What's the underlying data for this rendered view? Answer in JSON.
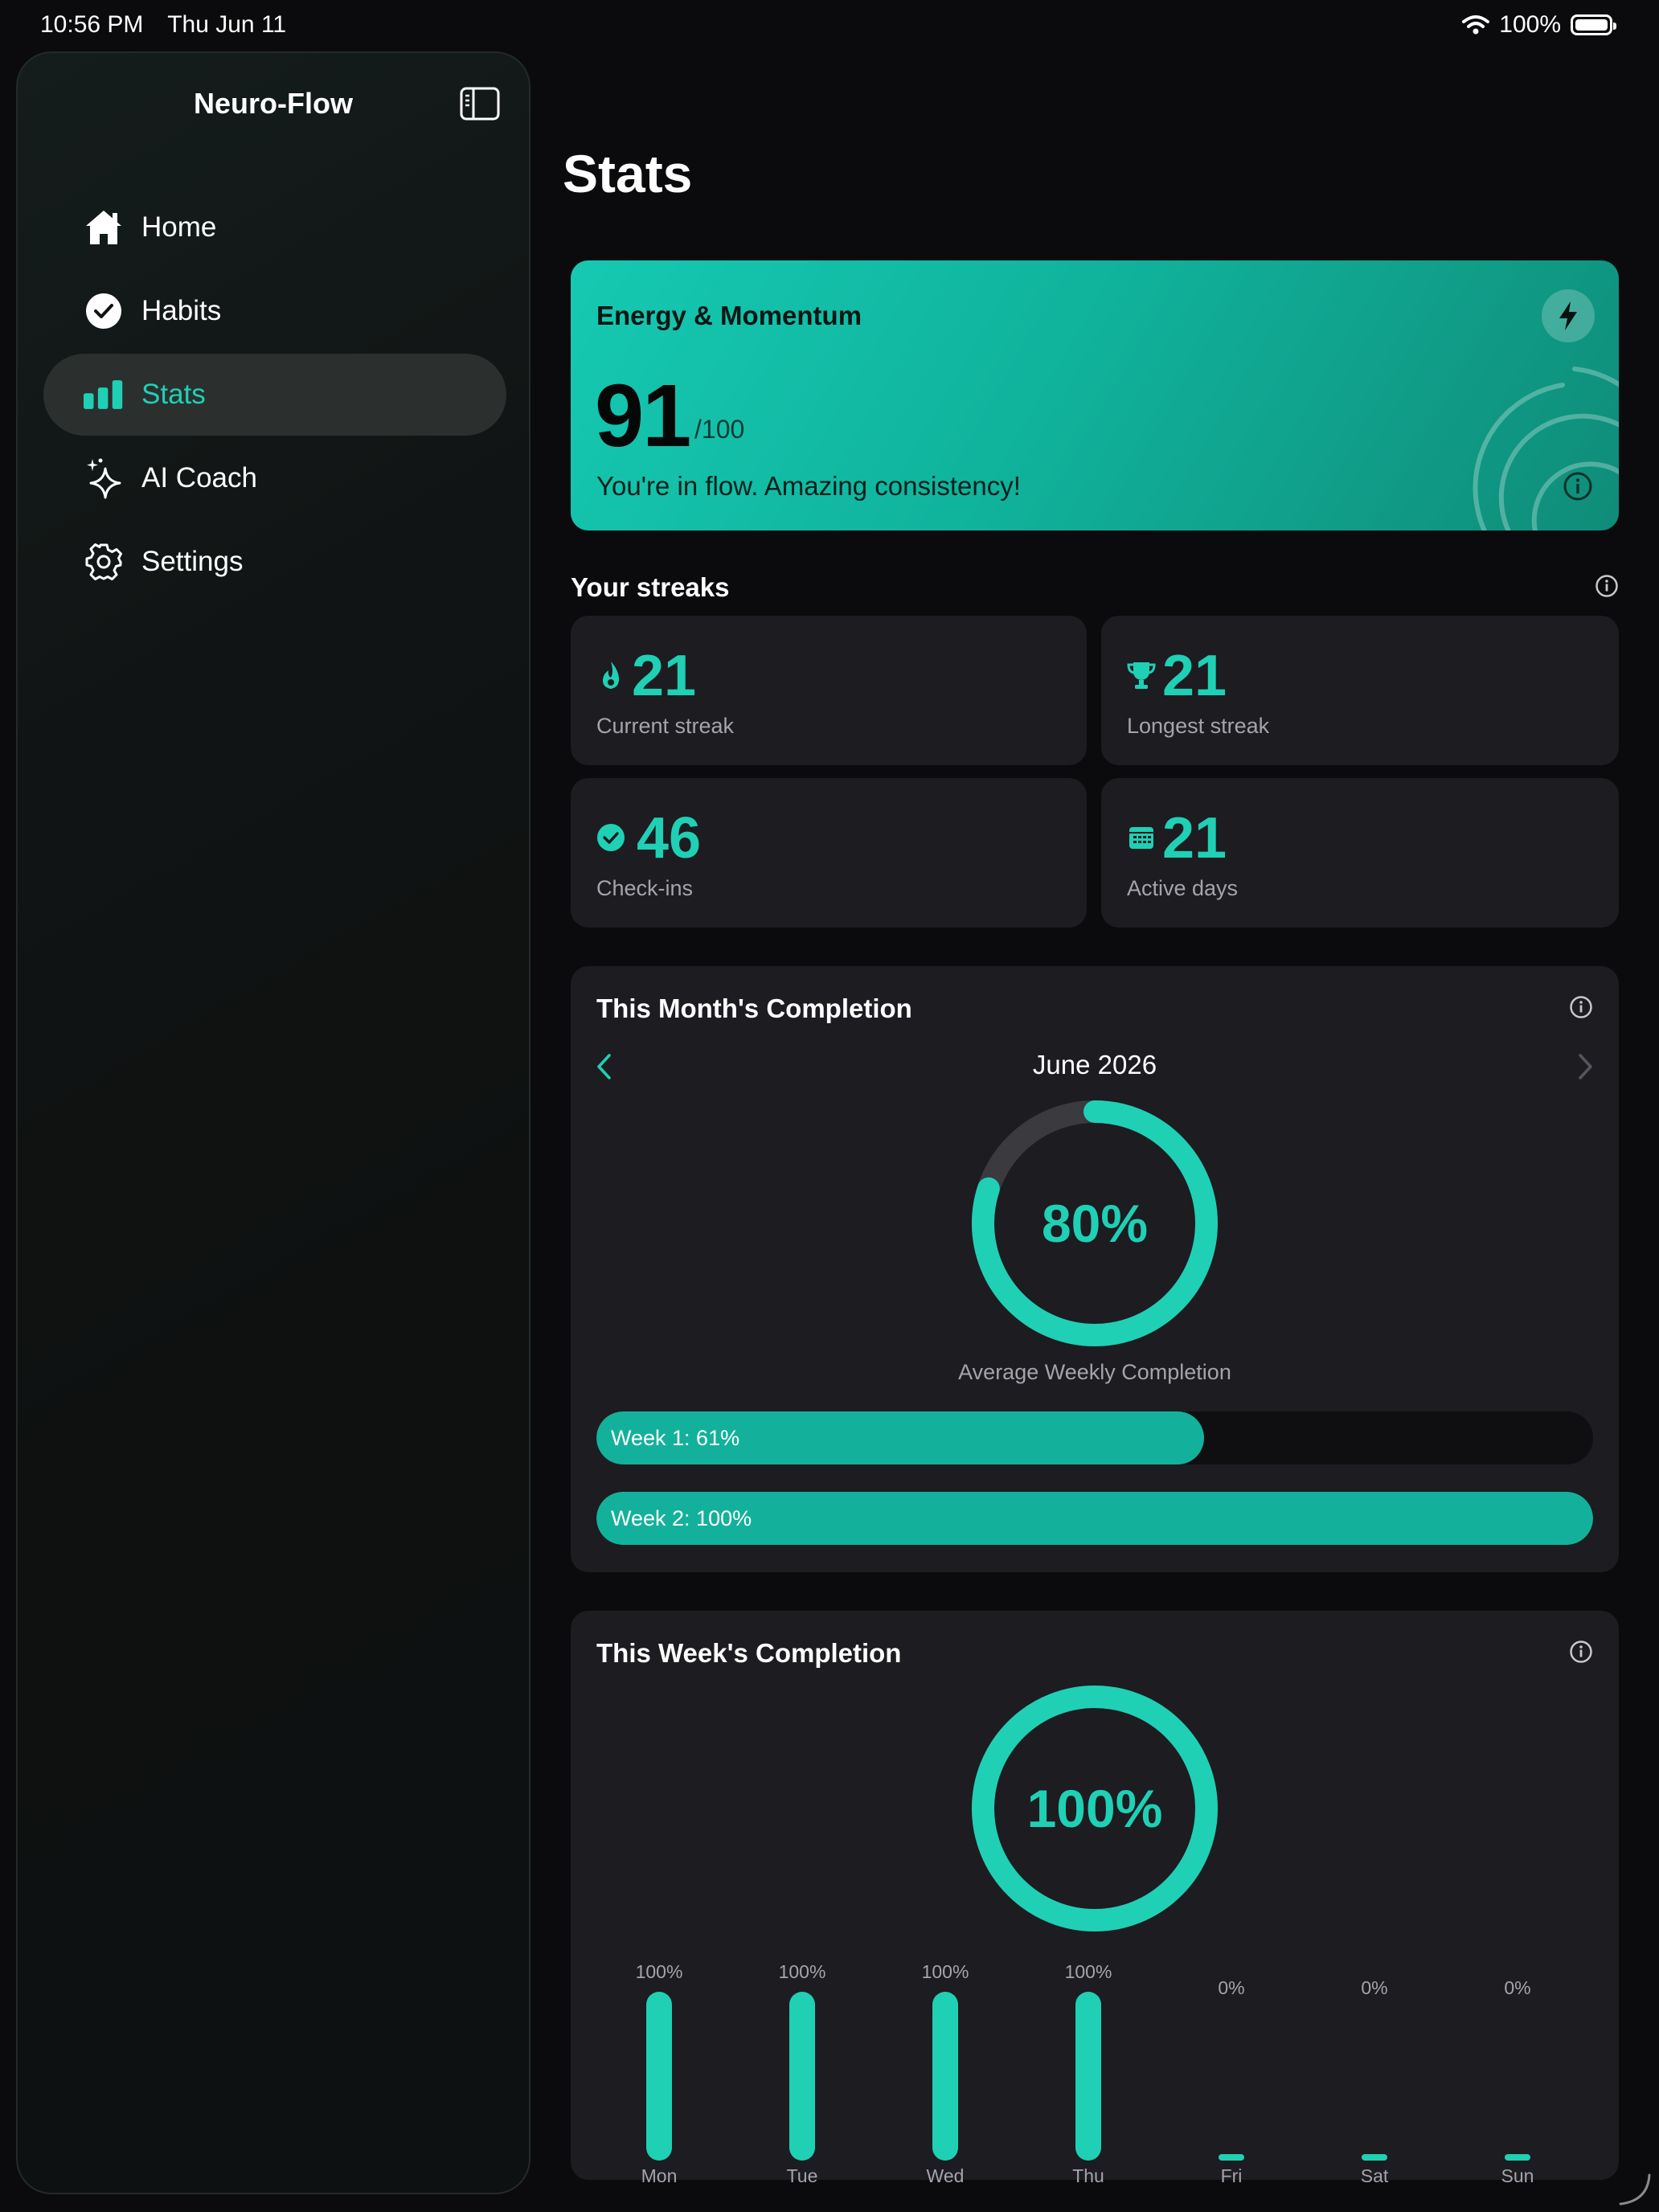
{
  "status_bar": {
    "time": "10:56 PM",
    "date": "Thu Jun 11",
    "battery": "100%",
    "icons": [
      "wifi-icon",
      "battery-icon"
    ]
  },
  "sidebar": {
    "title": "Neuro-Flow",
    "items": [
      {
        "label": "Home",
        "icon": "home-icon"
      },
      {
        "label": "Habits",
        "icon": "check-circle-icon"
      },
      {
        "label": "Stats",
        "icon": "bar-chart-icon",
        "active": true
      },
      {
        "label": "AI Coach",
        "icon": "sparkles-icon"
      },
      {
        "label": "Settings",
        "icon": "gear-icon"
      }
    ]
  },
  "page": {
    "title": "Stats"
  },
  "energy": {
    "title": "Energy & Momentum",
    "score": "91",
    "max": "/100",
    "message": "You're in flow. Amazing consistency!",
    "icons": [
      "bolt-icon",
      "info-icon"
    ]
  },
  "streaks": {
    "title": "Your streaks",
    "cards": [
      {
        "value": "21",
        "label": "Current streak",
        "icon": "flame-icon"
      },
      {
        "value": "21",
        "label": "Longest streak",
        "icon": "trophy-icon"
      },
      {
        "value": "46",
        "label": "Check-ins",
        "icon": "check-circle-icon"
      },
      {
        "value": "21",
        "label": "Active days",
        "icon": "calendar-icon"
      }
    ]
  },
  "month": {
    "title": "This Month's Completion",
    "month_label": "June 2026",
    "percent": 0.8,
    "percent_text": "80%",
    "caption": "Average Weekly Completion",
    "weeks": [
      {
        "label": "Week 1: 61%",
        "value": 0.61
      },
      {
        "label": "Week 2: 100%",
        "value": 1.0
      }
    ]
  },
  "week": {
    "title": "This Week's Completion",
    "percent": 1.0,
    "percent_text": "100%",
    "days": [
      {
        "label": "Mon",
        "pct": "100%",
        "value": 1.0
      },
      {
        "label": "Tue",
        "pct": "100%",
        "value": 1.0
      },
      {
        "label": "Wed",
        "pct": "100%",
        "value": 1.0
      },
      {
        "label": "Thu",
        "pct": "100%",
        "value": 1.0
      },
      {
        "label": "Fri",
        "pct": "0%",
        "value": 0
      },
      {
        "label": "Sat",
        "pct": "0%",
        "value": 0
      },
      {
        "label": "Sun",
        "pct": "0%",
        "value": 0
      }
    ]
  },
  "colors": {
    "accent": "#1fd0b5",
    "card": "#1c1c21",
    "background": "#0b0b0d"
  }
}
